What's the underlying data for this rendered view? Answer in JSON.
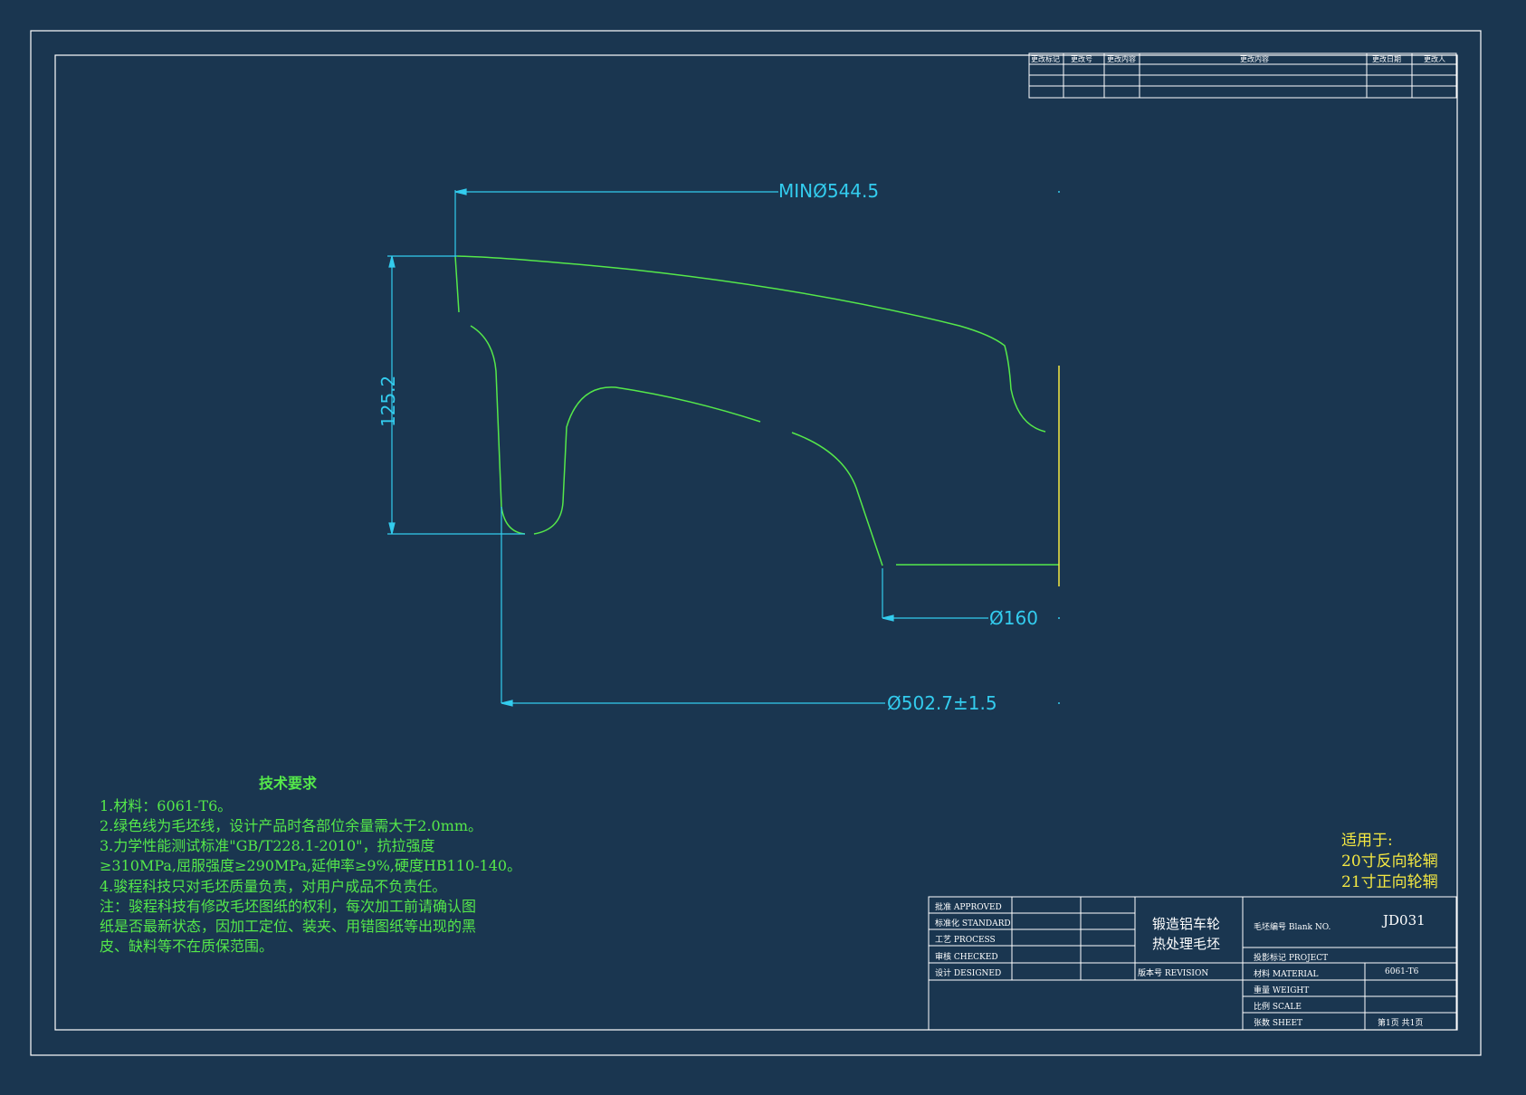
{
  "colors": {
    "background": "#1a3650",
    "frame": "#ffffff",
    "blank_line": "#55e84a",
    "dimension": "#33ccee",
    "yellow": "#f4e842"
  },
  "dimensions": {
    "outer_diameter": "MINØ544.5",
    "height": "125.2",
    "inner_diameter": "Ø160",
    "rim_diameter": "Ø502.7±1.5"
  },
  "technical_requirements": {
    "title": "技术要求",
    "lines": [
      "1.材料：6061-T6。",
      "2.绿色线为毛坯线，设计产品时各部位余量需大于2.0mm。",
      "3.力学性能测试标准\"GB/T228.1-2010\"，抗拉强度",
      "≥310MPa,屈服强度≥290MPa,延伸率≥9%,硬度HB110-140。",
      "4.骏程科技只对毛坯质量负责，对用户成品不负责任。",
      "注：骏程科技有修改毛坯图纸的权利，每次加工前请确认图",
      "纸是否最新状态，因加工定位、装夹、用错图纸等出现的黑",
      "皮、缺料等不在质保范围。"
    ]
  },
  "applies_to": {
    "label": "适用于:",
    "items": [
      "20寸反向轮辋",
      "21寸正向轮辋"
    ]
  },
  "revision_table": {
    "headers": [
      "更改标记",
      "更改号",
      "更改内容",
      "更改内容",
      "更改日期",
      "更改人"
    ]
  },
  "title_block": {
    "approved": "批准  APPROVED",
    "standard": "标准化 STANDARD",
    "process": "工艺  PROCESS",
    "checked": "审核  CHECKED",
    "designed": "设计  DESIGNED",
    "product_name_1": "锻造铝车轮",
    "product_name_2": "热处理毛坯",
    "revision": "版本号 REVISION",
    "blank_no_label": "毛坯编号 Blank NO.",
    "blank_no": "JD031",
    "project_label": "投影标记 PROJECT",
    "material_label": "材料 MATERIAL",
    "material": "6061-T6",
    "weight_label": "重量 WEIGHT",
    "scale_label": "比例 SCALE",
    "sheet_label": "张数 SHEET",
    "sheet": "第1页 共1页"
  }
}
